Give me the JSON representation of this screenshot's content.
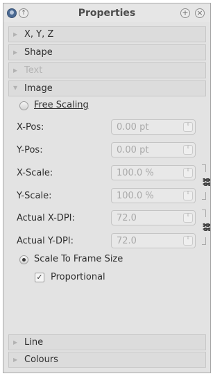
{
  "window": {
    "title": "Properties"
  },
  "titlebar": {
    "pin_glyph": "↑",
    "float_glyph": "+",
    "close_glyph": "×"
  },
  "sections": {
    "xyz": {
      "label": "X, Y, Z",
      "state": "collapsed"
    },
    "shape": {
      "label": "Shape",
      "state": "collapsed"
    },
    "text": {
      "label": "Text",
      "state": "disabled"
    },
    "image": {
      "label": "Image",
      "state": "expanded"
    },
    "line": {
      "label": "Line",
      "state": "collapsed"
    },
    "colours": {
      "label": "Colours",
      "state": "collapsed"
    }
  },
  "image_panel": {
    "free_scaling": {
      "label": "Free Scaling",
      "checked": false
    },
    "fields": {
      "xpos": {
        "label": "X-Pos:",
        "value": "0.00 pt"
      },
      "ypos": {
        "label": "Y-Pos:",
        "value": "0.00 pt"
      },
      "xscale": {
        "label": "X-Scale:",
        "value": "100.0 %"
      },
      "yscale": {
        "label": "Y-Scale:",
        "value": "100.0 %"
      },
      "xdpi": {
        "label": "Actual X-DPI:",
        "value": "72.0"
      },
      "ydpi": {
        "label": "Actual Y-DPI:",
        "value": "72.0"
      }
    },
    "scale_to_frame": {
      "label": "Scale To Frame Size",
      "checked": true
    },
    "proportional": {
      "label": "Proportional",
      "checked": true
    }
  },
  "icons": {
    "app": "app-icon",
    "section_arrow_collapsed": "▶",
    "section_arrow_expanded": "▼",
    "chain_link": "⛓",
    "spin_arrows": "⇕",
    "checkmark": "✓"
  },
  "colors": {
    "panel_bg": "#e3e3e3",
    "section_bg": "#dcdcdc",
    "disabled_text": "#b4b4b4"
  }
}
